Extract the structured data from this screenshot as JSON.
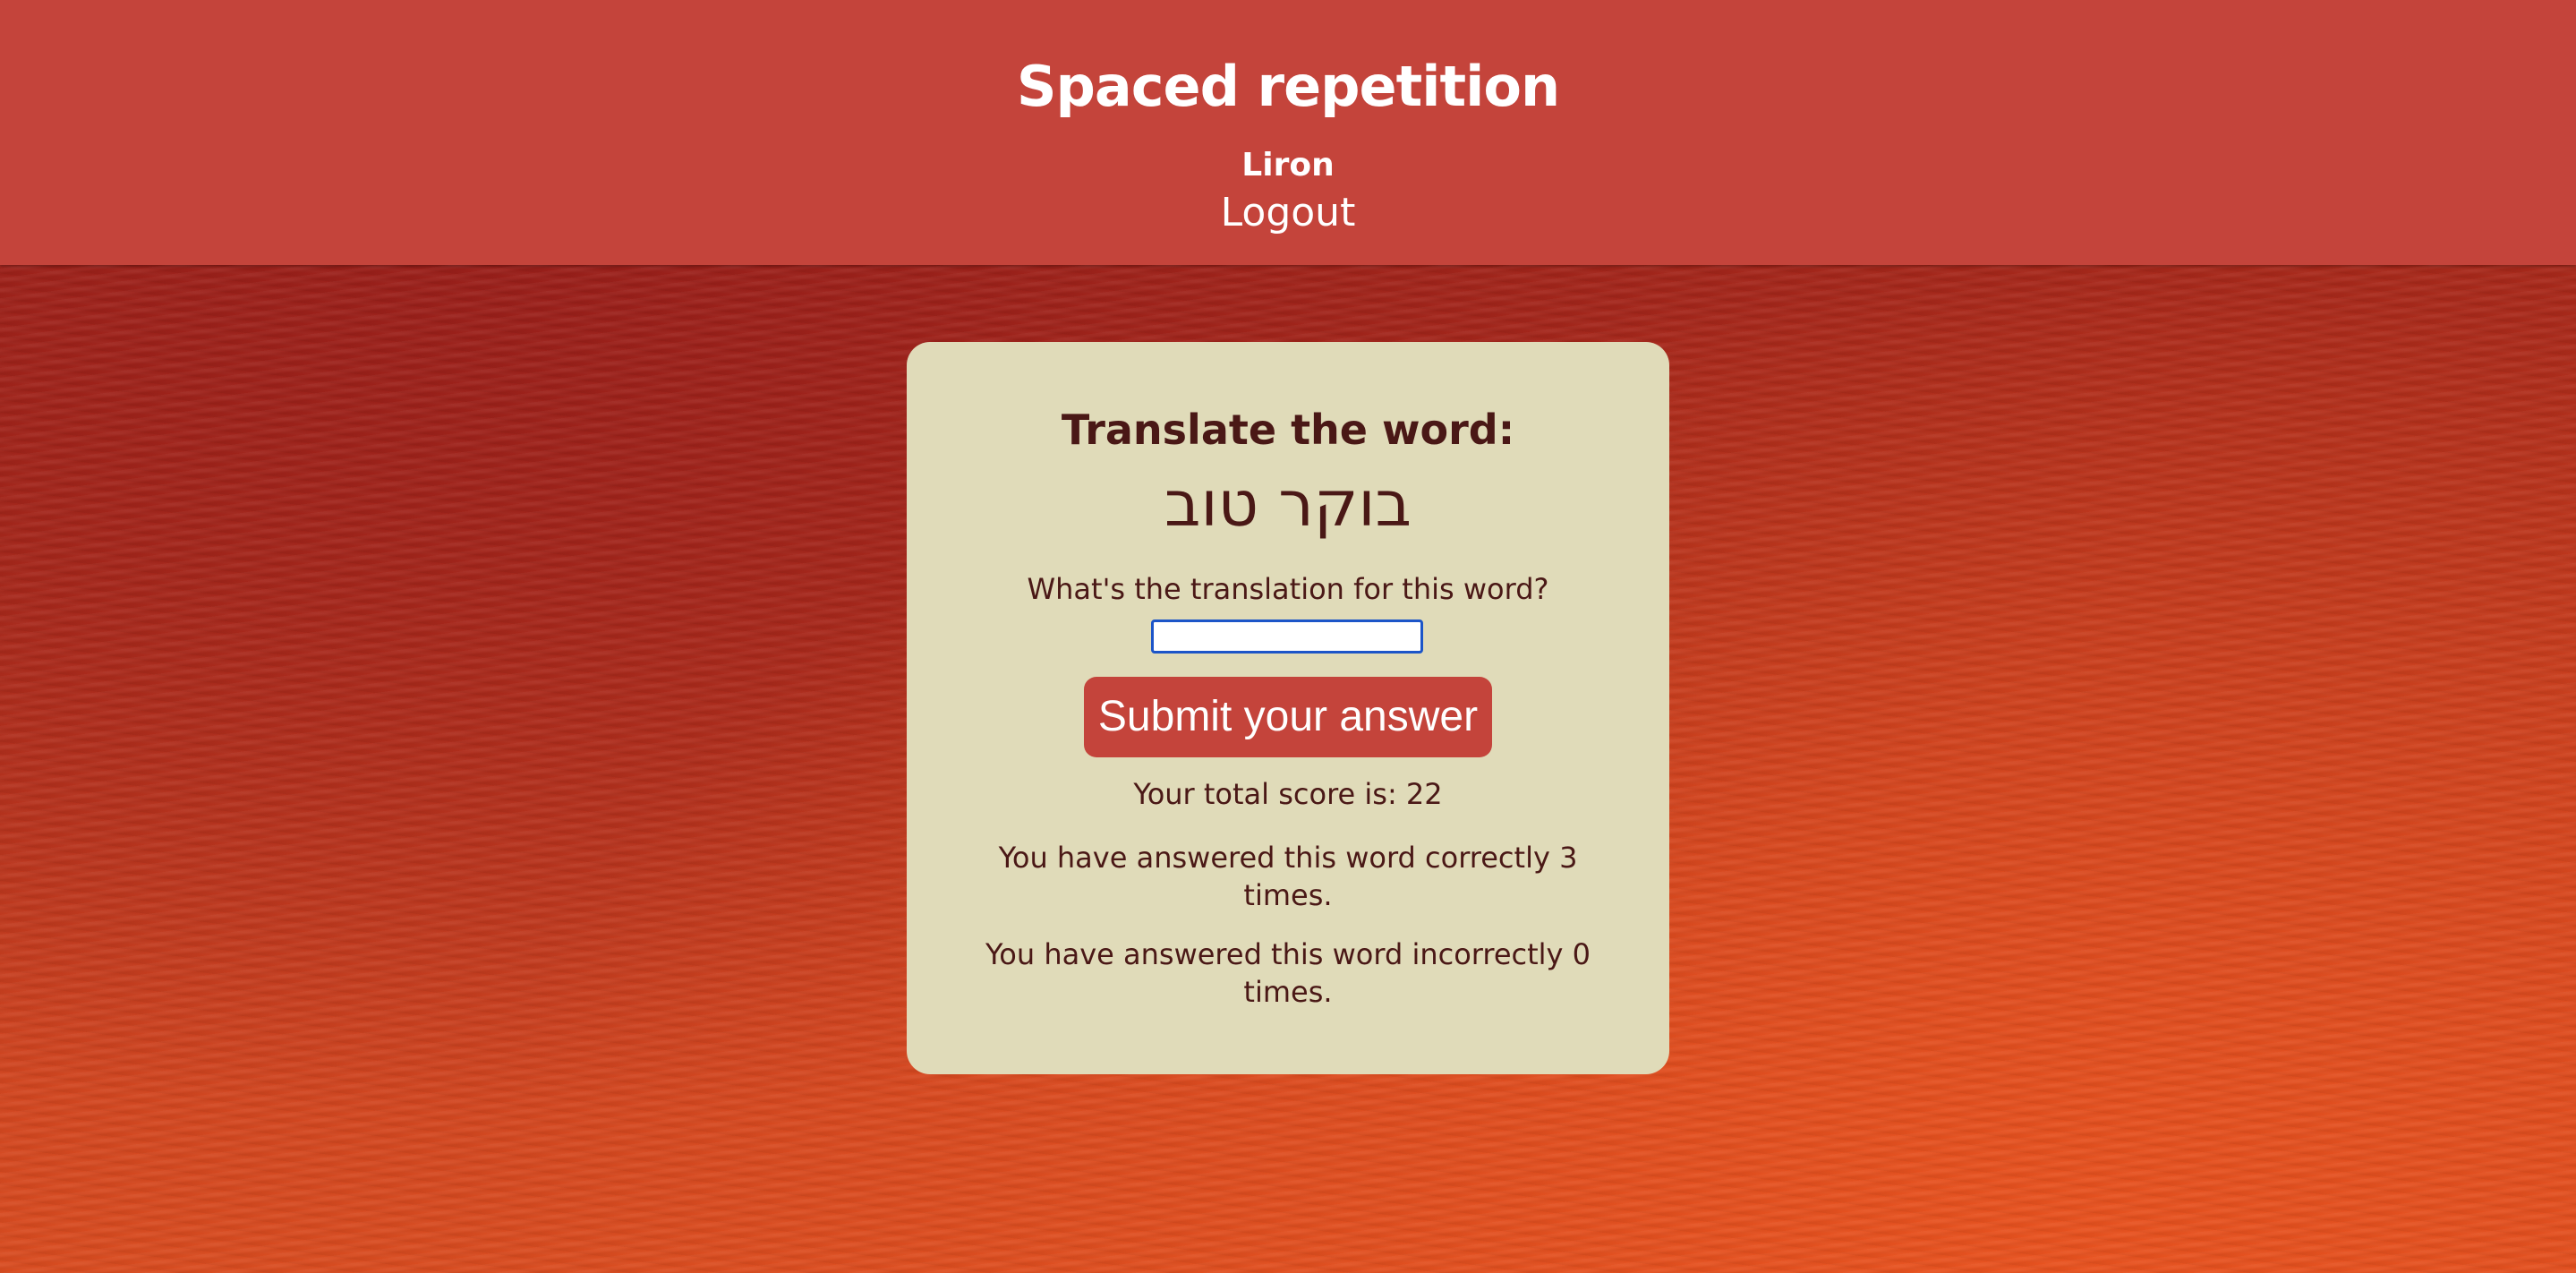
{
  "header": {
    "title": "Spaced repetition",
    "user_name": "Liron",
    "logout_label": "Logout"
  },
  "card": {
    "heading": "Translate the word:",
    "word": "בוקר טוב",
    "question": "What's the translation for this word?",
    "answer_value": "",
    "submit_label": "Submit your answer",
    "total_score_text": "Your total score is: 22",
    "correct_text": "You have answered this word correctly 3 times.",
    "incorrect_text": "You have answered this word incorrectly 0 times."
  },
  "colors": {
    "header_bg": "#c4443b",
    "card_bg": "#e0dbb9",
    "text": "#4a1816",
    "button_bg": "#c4443b",
    "input_focus_border": "#1c55c8"
  }
}
